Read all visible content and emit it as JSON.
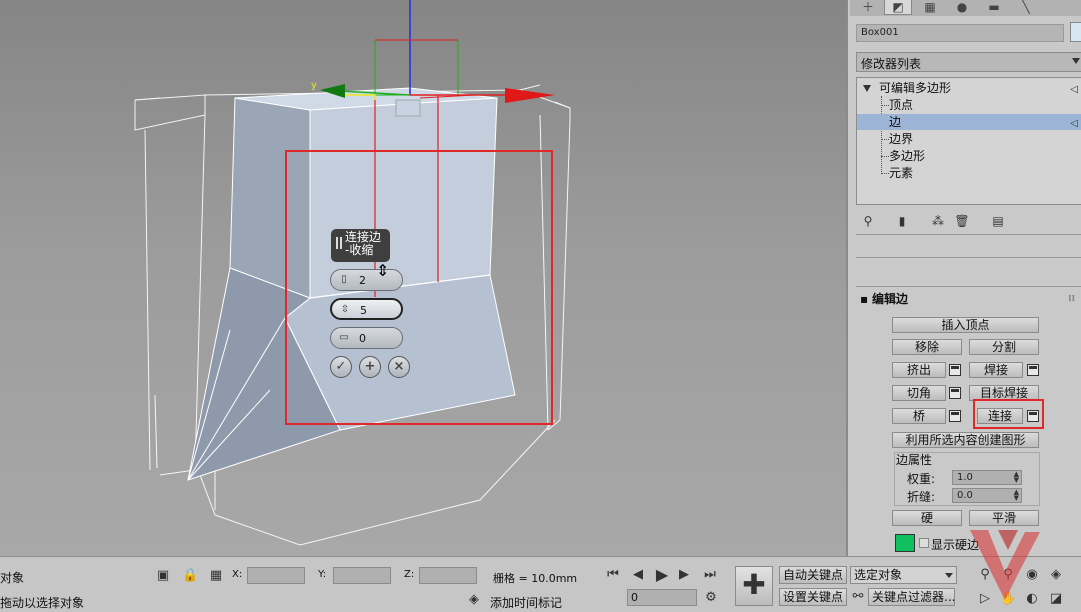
{
  "viewport": {
    "caddy": {
      "title_line1": "连接边",
      "title_line2": "-收缩",
      "segments": "2",
      "pinch": "5",
      "slide": "0"
    },
    "gizmo": {
      "y_label": "y"
    }
  },
  "command_panel": {
    "tabs": [
      "create-icon",
      "modify-icon",
      "hierarchy-icon",
      "motion-icon",
      "display-icon",
      "utilities-icon"
    ],
    "object_name": "Box001",
    "modifier_list": "修改器列表",
    "stack": {
      "root": "可编辑多边形",
      "items": [
        "顶点",
        "边",
        "边界",
        "多边形",
        "元素"
      ],
      "selected": "边"
    },
    "edit_edges": {
      "title": "编辑边",
      "insert_vertex": "插入顶点",
      "remove": "移除",
      "split": "分割",
      "extrude": "挤出",
      "weld": "焊接",
      "chamfer": "切角",
      "target_weld": "目标焊接",
      "bridge": "桥",
      "connect": "连接",
      "create_shape": "利用所选内容创建图形",
      "edge_properties": "边属性",
      "weight_label": "权重:",
      "weight_value": "1.0",
      "crease_label": "折缝:",
      "crease_value": "0.0",
      "hard": "硬",
      "smooth": "平滑",
      "display_hard": "显示硬边",
      "hard_edge_color": "#10c060"
    }
  },
  "status": {
    "selected_line": "对象",
    "prompt": "拖动以选择对象",
    "x_label": "X:",
    "y_label": "Y:",
    "z_label": "Z:",
    "grid": "栅格 = 10.0mm",
    "add_time_tag": "添加时间标记",
    "frame": "0",
    "auto_key": "自动关键点",
    "set_key": "设置关键点",
    "selection_set": "选定对象",
    "key_filters": "关键点过滤器..."
  }
}
